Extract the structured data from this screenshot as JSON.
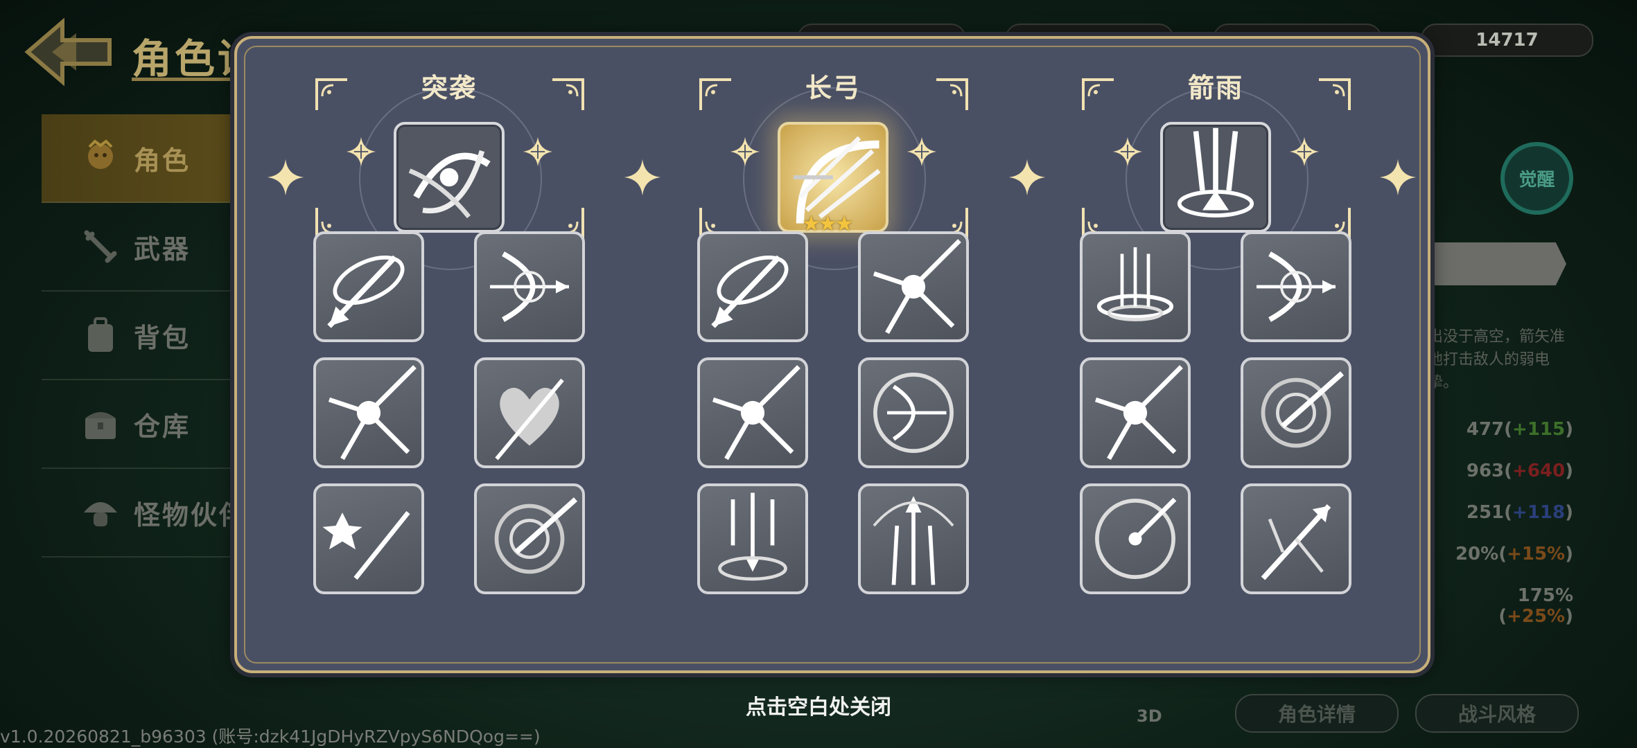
{
  "background": {
    "page_title": "角色详情",
    "side_nav": [
      {
        "label": "角色",
        "icon": "character-icon",
        "active": true
      },
      {
        "label": "武器",
        "icon": "sword-icon",
        "active": false
      },
      {
        "label": "背包",
        "icon": "backpack-icon",
        "active": false
      },
      {
        "label": "仓库",
        "icon": "chest-icon",
        "active": false
      },
      {
        "label": "怪物伙伴",
        "icon": "mushroom-pet-icon",
        "active": false
      }
    ],
    "resources": [
      {
        "icon": "coin-icon",
        "value": ""
      },
      {
        "icon": "gem-icon",
        "value": ""
      },
      {
        "icon": "clover-icon",
        "value": ""
      },
      {
        "icon": "potion-icon",
        "value": "14717"
      }
    ],
    "awaken_label": "觉醒",
    "description": "出没于高空，箭矢准地打击敌人的弱电挚。",
    "stats": [
      {
        "base": "477",
        "bonus": "+115",
        "color": "#3d6f2a"
      },
      {
        "base": "963",
        "bonus": "+640",
        "color": "#7a1f1f"
      },
      {
        "base": "251",
        "bonus": "+118",
        "color": "#2a3f7a"
      },
      {
        "base": "20%",
        "bonus": "+15%",
        "color": "#7a4a1a"
      },
      {
        "base": "175%",
        "bonus": "+25%",
        "color": "#7a4a1a"
      }
    ],
    "btn_3d": "3D",
    "btn_character_details": "角色详情",
    "btn_combat_style": "战斗风格",
    "version": "v1.0.20260821_b96303 (账号:dzk41JgDHyRZVpyS6NDQog==)"
  },
  "modal": {
    "close_hint": "点击空白处关闭",
    "branches": [
      {
        "title": "突袭",
        "selected": false,
        "stars": "",
        "main_icon": "vortex-slash-icon",
        "skills": [
          "ring-arrow-icon",
          "bow-multishot-icon",
          "piercing-arrow-icon",
          "heart-arrows-icon",
          "star-arrows-icon",
          "vortex-arrow-icon"
        ]
      },
      {
        "title": "长弓",
        "selected": true,
        "stars": "★★★",
        "main_icon": "longbow-burst-icon",
        "skills": [
          "spin-strike-icon",
          "scatter-arrows-icon",
          "impact-arrow-icon",
          "compass-bow-icon",
          "arrow-rain-down-icon",
          "rising-arrows-icon"
        ]
      },
      {
        "title": "箭雨",
        "selected": false,
        "stars": "",
        "main_icon": "arrow-rain-icon",
        "skills": [
          "arrow-tornado-icon",
          "bow-up-icon",
          "volley-arrows-icon",
          "swirl-arrows-icon",
          "target-arrow-icon",
          "split-arrow-icon"
        ]
      }
    ]
  }
}
